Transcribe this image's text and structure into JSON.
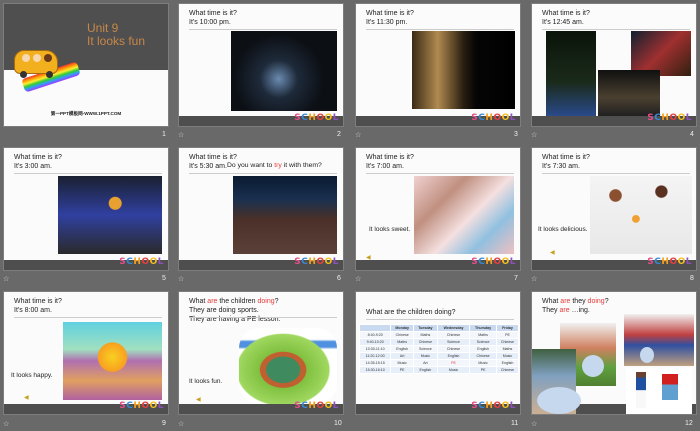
{
  "slides": [
    {
      "number": "1",
      "title_line1": "Unit 9",
      "title_line2": "It looks fun",
      "footer": "第一PPT模板网-WWW.1PPT.COM",
      "title_color": "#c8874a"
    },
    {
      "number": "2",
      "line1": "What time is it?",
      "line2": "It's 10:00  pm."
    },
    {
      "number": "3",
      "line1": "What time is it?",
      "line2": "It's 11:30  pm."
    },
    {
      "number": "4",
      "line1": "What time is it?",
      "line2": "It's 12:45  am."
    },
    {
      "number": "5",
      "line1": "What time is it?",
      "line2": "It's 3:00  am."
    },
    {
      "number": "6",
      "line1": "What time is it?",
      "line2": "It's 5:30  am.",
      "overlay_pre": "Do  you  want  to ",
      "overlay_red": "try",
      "overlay_post": " it  with  them?"
    },
    {
      "number": "7",
      "line1": "What time is it?",
      "line2": "It's 7:00  am.",
      "note": "It looks  sweet."
    },
    {
      "number": "8",
      "line1": "What time is it?",
      "line2": "It's 7:30  am.",
      "note": "It looks  delicious."
    },
    {
      "number": "9",
      "line1": "What time is it?",
      "line2": "It's 8:00  am.",
      "note": "It looks  happy."
    },
    {
      "number": "10",
      "q_what": "What ",
      "q_are": "are",
      "q_mid": " the  children ",
      "q_doing": "doing",
      "q_end": "?",
      "line2": "They  are  doing  sports.",
      "line3": "They  are  having   a PE  lesson.",
      "note": "It looks  fun."
    },
    {
      "number": "11",
      "title": "What are the children doing?",
      "table": {
        "headers": [
          "",
          "Monday",
          "Tuesday",
          "Wednesday",
          "Thursday",
          "Friday"
        ],
        "rows": [
          [
            "8:40-9:20",
            "Chinese",
            "Maths",
            "Chinese",
            "Maths",
            "PE"
          ],
          [
            "9:40-10:20",
            "Maths",
            "Chinese",
            "Science",
            "Science",
            "Chinese"
          ],
          [
            "10:30-11:10",
            "English",
            "Science",
            "Chinese",
            "English",
            "Maths"
          ],
          [
            "11:20-12:00",
            "Art",
            "Music",
            "English",
            "Chinese",
            "Music"
          ],
          [
            "14:35-15:15",
            "Music",
            "Art",
            "PE",
            "Music",
            "English"
          ],
          [
            "15:30-16:10",
            "PE",
            "English",
            "Music",
            "PE",
            "Chinese"
          ]
        ]
      }
    },
    {
      "number": "12",
      "q_what": "What ",
      "q_are": "are",
      "q_mid": " they ",
      "q_doing": "doing",
      "q_end": "?",
      "a_they": " They ",
      "a_are": "are",
      "a_ing": " …ing."
    }
  ],
  "logo_text": [
    "S",
    "C",
    "H",
    "O",
    "O",
    "L"
  ],
  "icons": {
    "transition": "star-icon",
    "audio": "speaker-icon"
  },
  "colors": {
    "background": "#696969",
    "accent_red": "#e83a3a",
    "bar": "#4e4e4e"
  }
}
